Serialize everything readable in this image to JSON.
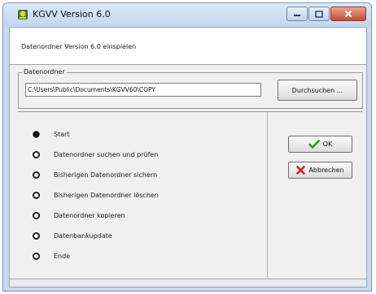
{
  "window": {
    "title": "KGVV Version 6.0",
    "icon": "kgvv-app-icon",
    "minimize_icon": "minimize-icon",
    "maximize_icon": "maximize-icon",
    "close_icon": "close-icon"
  },
  "header": {
    "subtitle": "Datenordner Version 6.0 einspielen"
  },
  "folder_group": {
    "label": "Datenordner",
    "path_value": "C:\\Users\\Public\\Documents\\KGVV60\\COPY",
    "browse_label": "Durchsuchen ..."
  },
  "steps": [
    {
      "label": "Start",
      "active": true
    },
    {
      "label": "Datenordner suchen und prüfen",
      "active": false
    },
    {
      "label": "Bisherigen Datenordner sichern",
      "active": false
    },
    {
      "label": "Bisherigen Datenordner löschen",
      "active": false
    },
    {
      "label": "Datenordner kopieren",
      "active": false
    },
    {
      "label": "Datenbankupdate",
      "active": false
    },
    {
      "label": "Ende",
      "active": false
    }
  ],
  "actions": {
    "ok_label": "OK",
    "ok_icon": "checkmark-icon",
    "cancel_label": "Abbrechen",
    "cancel_icon": "x-mark-icon"
  },
  "colors": {
    "ok_check": "#2e9a1f",
    "cancel_x": "#c8261a",
    "title_bar": "#c9daf1",
    "close_button": "#c74b32"
  }
}
